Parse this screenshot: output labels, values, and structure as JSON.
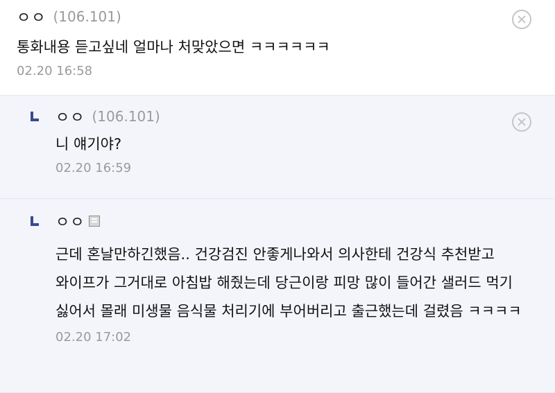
{
  "comments": [
    {
      "nickname": "ㅇㅇ",
      "ip": "(106.101)",
      "text": "통화내용 듣고싶네 얼마나 처맞았으면 ㅋㅋㅋㅋㅋㅋ",
      "time": "02.20 16:58",
      "icons": [
        "delete-icon"
      ]
    },
    {
      "nickname": "ㅇㅇ",
      "ip": "(106.101)",
      "text": "니 얘기야?",
      "time": "02.20 16:59",
      "icons": [
        "reply-arrow-icon",
        "delete-icon"
      ]
    },
    {
      "nickname": "ㅇㅇ",
      "text": "근데 혼날만하긴했음.. 건강검진 안좋게나와서 의사한테 건강식 추천받고 와이프가 그거대로 아침밥 해줬는데 당근이랑 피망 많이 들어간 샐러드 먹기 싫어서 몰래 미생물 음식물 처리기에 부어버리고 출근했는데 걸렸음 ㅋㅋㅋㅋ",
      "time": "02.20 17:02",
      "icons": [
        "reply-arrow-icon",
        "fixed-nick-badge-icon"
      ]
    }
  ],
  "colors": {
    "reply_background": "#f4f5fb",
    "reply_arrow": "#3b4890",
    "meta_text": "#9a9a9a"
  }
}
